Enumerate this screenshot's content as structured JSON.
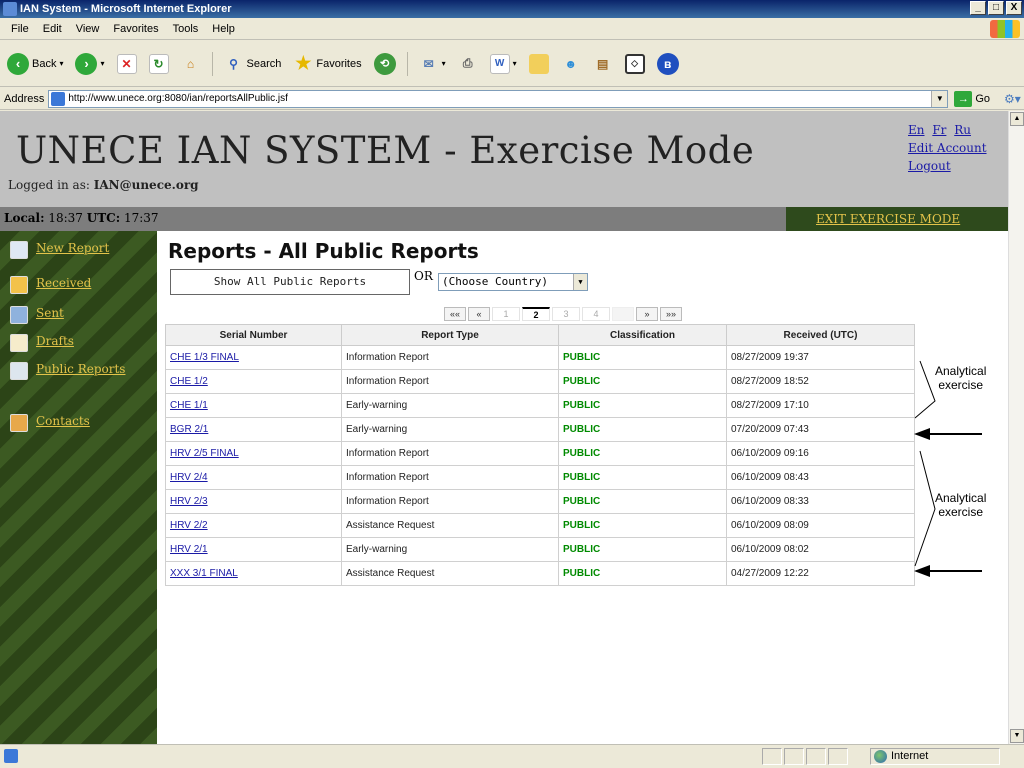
{
  "window": {
    "title": "IAN System - Microsoft Internet Explorer",
    "controls": [
      "_",
      "□",
      "X"
    ]
  },
  "menu": [
    "File",
    "Edit",
    "View",
    "Favorites",
    "Tools",
    "Help"
  ],
  "toolbar": {
    "back": "Back",
    "search": "Search",
    "favorites": "Favorites"
  },
  "address": {
    "label": "Address",
    "url": "http://www.unece.org:8080/ian/reportsAllPublic.jsf",
    "go": "Go"
  },
  "header": {
    "title": "UNECE IAN SYSTEM - Exercise Mode",
    "logged_prefix": "Logged in as:",
    "logged_user": "IAN@unece.org",
    "lang_en": "En",
    "lang_fr": "Fr",
    "lang_ru": "Ru",
    "edit_account": "Edit Account",
    "logout": "Logout"
  },
  "timebar": {
    "local_label": "Local:",
    "local_time": "18:37",
    "utc_label": "UTC:",
    "utc_time": "17:37",
    "exit": "EXIT EXERCISE MODE"
  },
  "sidebar": {
    "items": [
      {
        "label": "New Report",
        "icon": "new-report-icon"
      },
      {
        "label": "Received",
        "icon": "received-icon"
      },
      {
        "label": "Sent",
        "icon": "sent-icon"
      },
      {
        "label": "Drafts",
        "icon": "drafts-icon"
      },
      {
        "label": "Public Reports",
        "icon": "public-reports-icon"
      },
      {
        "label": "Contacts",
        "icon": "contacts-icon"
      }
    ]
  },
  "main": {
    "title": "Reports - All Public Reports",
    "show_all": "Show All Public Reports",
    "or": "OR",
    "country_select": "(Choose Country)",
    "pager": {
      "first": "««",
      "prev": "«",
      "pages": [
        "1",
        "2",
        "3",
        "4"
      ],
      "current": "2",
      "next": "»",
      "last": "»»"
    },
    "table": {
      "headers": [
        "Serial Number",
        "Report Type",
        "Classification",
        "Received (UTC)"
      ],
      "rows": [
        [
          "CHE 1/3 FINAL",
          "Information Report",
          "PUBLIC",
          "08/27/2009 19:37"
        ],
        [
          "CHE 1/2",
          "Information Report",
          "PUBLIC",
          "08/27/2009 18:52"
        ],
        [
          "CHE 1/1",
          "Early-warning",
          "PUBLIC",
          "08/27/2009 17:10"
        ],
        [
          "BGR 2/1",
          "Early-warning",
          "PUBLIC",
          "07/20/2009 07:43"
        ],
        [
          "HRV 2/5 FINAL",
          "Information Report",
          "PUBLIC",
          "06/10/2009 09:16"
        ],
        [
          "HRV 2/4",
          "Information Report",
          "PUBLIC",
          "06/10/2009 08:43"
        ],
        [
          "HRV 2/3",
          "Information Report",
          "PUBLIC",
          "06/10/2009 08:33"
        ],
        [
          "HRV 2/2",
          "Assistance Request",
          "PUBLIC",
          "06/10/2009 08:09"
        ],
        [
          "HRV 2/1",
          "Early-warning",
          "PUBLIC",
          "06/10/2009 08:02"
        ],
        [
          "XXX 3/1 FINAL",
          "Assistance Request",
          "PUBLIC",
          "04/27/2009 12:22"
        ]
      ]
    },
    "annotations": [
      {
        "line1": "Analytical",
        "line2": "exercise"
      },
      {
        "line1": "Analytical",
        "line2": "exercise"
      }
    ]
  },
  "status": {
    "zone": "Internet"
  },
  "colors": {
    "header_bg": "#c0c0c0",
    "sidebar_dark": "#2c4417",
    "link_gold": "#e3c34a",
    "public_green": "#008a00",
    "link_blue": "#1a1aa6"
  }
}
